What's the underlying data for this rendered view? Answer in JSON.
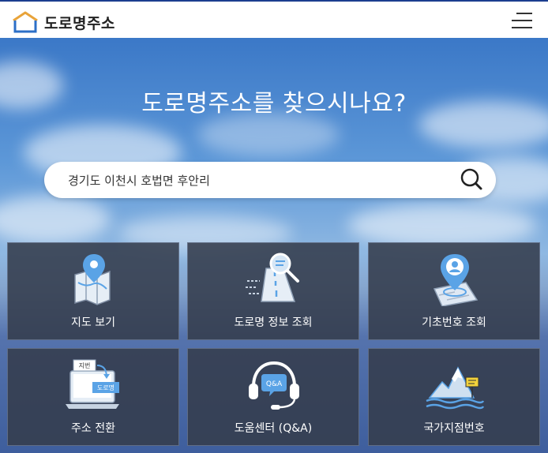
{
  "header": {
    "logo_text": "도로명주소",
    "menu_icon": "hamburger-menu-icon"
  },
  "hero": {
    "headline": "도로명주소를 찾으시나요?"
  },
  "search": {
    "value": "경기도 이천시 호법면 후안리",
    "icon": "search-icon"
  },
  "tiles": [
    {
      "label": "지도 보기",
      "icon": "map-pin-icon"
    },
    {
      "label": "도로명 정보 조회",
      "icon": "road-search-icon"
    },
    {
      "label": "기초번호 조회",
      "icon": "location-pin-map-icon"
    },
    {
      "label": "주소 전환",
      "icon": "address-convert-icon",
      "badge_old": "지번",
      "badge_new": "도로명"
    },
    {
      "label": "도움센터 (Q&A)",
      "icon": "headset-qa-icon",
      "badge": "Q&A"
    },
    {
      "label": "국가지점번호",
      "icon": "mountain-sign-icon"
    }
  ],
  "colors": {
    "header_border": "#1b3d8f",
    "tile_bg": "#343c4c",
    "icon_blue": "#5aa3e6"
  }
}
